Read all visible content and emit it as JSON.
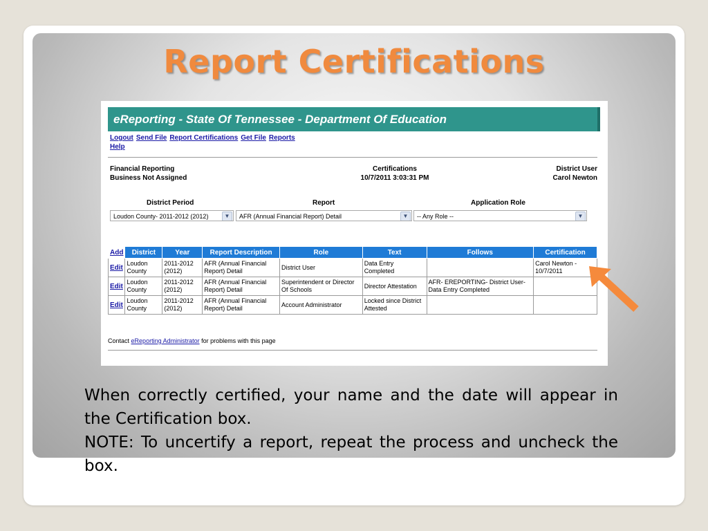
{
  "slide": {
    "title": "Report Certifications",
    "note_line1": "When correctly certified, your name and the date will appear in the Certification box.",
    "note_line2": "NOTE: To uncertify a report, repeat the process and uncheck the box.",
    "title_color": "#f08a3e",
    "arrow_color": "#f58a3c"
  },
  "app": {
    "banner": "eReporting - State Of Tennessee - Department Of Education",
    "banner_color": "#2f958c",
    "nav": [
      "Logout",
      "Send File",
      "Report Certifications",
      "Get File",
      "Reports",
      "Help"
    ],
    "left_line1": "Financial Reporting",
    "left_line2": "Business Not Assigned",
    "center_line1": "Certifications",
    "center_line2": "10/7/2011 3:03:31 PM",
    "right_line1": "District User",
    "right_line2": "Carol Newton"
  },
  "filters": {
    "district_period_label": "District Period",
    "district_period_value": "Loudon County- 2011-2012 (2012)",
    "report_label": "Report",
    "report_value": "AFR (Annual Financial Report) Detail",
    "role_label": "Application Role",
    "role_value": "-- Any Role --"
  },
  "table": {
    "add_label": "Add",
    "headers": [
      "District",
      "Year",
      "Report Description",
      "Role",
      "Text",
      "Follows",
      "Certification"
    ],
    "header_color": "#1f7bd6",
    "rows": [
      {
        "edit": "Edit",
        "district": "Loudon County",
        "year": "2011-2012 (2012)",
        "desc": "AFR (Annual Financial Report) Detail",
        "role": "District User",
        "text": "Data Entry Completed",
        "follows": "",
        "cert": "Carol Newton - 10/7/2011"
      },
      {
        "edit": "Edit",
        "district": "Loudon County",
        "year": "2011-2012 (2012)",
        "desc": "AFR (Annual Financial Report) Detail",
        "role": "Superintendent or Director Of Schools",
        "text": "Director Attestation",
        "follows": "AFR- EREPORTING- District User- Data Entry Completed",
        "cert": ""
      },
      {
        "edit": "Edit",
        "district": "Loudon County",
        "year": "2011-2012 (2012)",
        "desc": "AFR (Annual Financial Report) Detail",
        "role": "Account Administrator",
        "text": "Locked since District Attested",
        "follows": "",
        "cert": ""
      }
    ]
  },
  "footer": {
    "contact_prefix": "Contact",
    "contact_link": "eReporting Administrator",
    "contact_suffix": "for problems with this page"
  }
}
